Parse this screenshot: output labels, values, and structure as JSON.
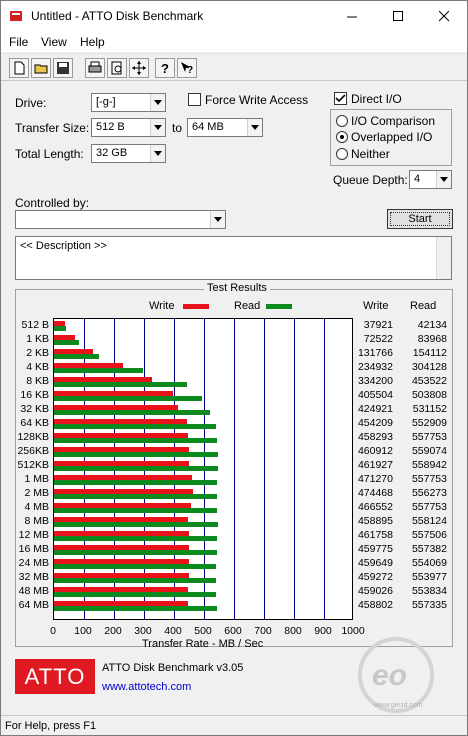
{
  "window": {
    "title": "Untitled - ATTO Disk Benchmark"
  },
  "menu": {
    "items": [
      "File",
      "View",
      "Help"
    ]
  },
  "controls": {
    "drive_label": "Drive:",
    "drive_value": "[-g-]",
    "force_write_label": "Force Write Access",
    "force_write_checked": false,
    "transfer_size_label": "Transfer Size:",
    "transfer_from": "512 B",
    "to_label": "to",
    "transfer_to": "64 MB",
    "total_length_label": "Total Length:",
    "total_length_value": "32 GB",
    "direct_io_label": "Direct I/O",
    "direct_io_checked": true,
    "io_comparison_label": "I/O Comparison",
    "overlapped_io_label": "Overlapped I/O",
    "neither_label": "Neither",
    "selected_io": "Overlapped I/O",
    "queue_depth_label": "Queue Depth:",
    "queue_depth_value": "4",
    "controlled_by_label": "Controlled by:",
    "controlled_by_value": "",
    "start_label": "Start",
    "description_text": "<< Description >>"
  },
  "results": {
    "title": "Test Results",
    "legend_write": "Write",
    "legend_read": "Read",
    "col_write": "Write",
    "col_read": "Read",
    "x_axis_label": "Transfer Rate - MB / Sec",
    "x_ticks": [
      "0",
      "100",
      "200",
      "300",
      "400",
      "500",
      "600",
      "700",
      "800",
      "900",
      "1000"
    ],
    "write_color": "#e8131a",
    "read_color": "#0d8a1d"
  },
  "chart_data": {
    "type": "bar",
    "orientation": "horizontal",
    "xlabel": "Transfer Rate - MB / Sec",
    "xlim": [
      0,
      1000
    ],
    "categories": [
      "512 B",
      "1 KB",
      "2 KB",
      "4 KB",
      "8 KB",
      "16 KB",
      "32 KB",
      "64 KB",
      "128KB",
      "256KB",
      "512KB",
      "1 MB",
      "2 MB",
      "4 MB",
      "8 MB",
      "12 MB",
      "16 MB",
      "24 MB",
      "32 MB",
      "48 MB",
      "64 MB"
    ],
    "series": [
      {
        "name": "Write",
        "values": [
          37921,
          72522,
          131766,
          234932,
          334200,
          405504,
          424921,
          454209,
          458293,
          460912,
          461927,
          471270,
          474468,
          466552,
          458895,
          461758,
          459775,
          459649,
          459272,
          459026,
          458802
        ]
      },
      {
        "name": "Read",
        "values": [
          42134,
          83968,
          154112,
          304128,
          453522,
          503808,
          531152,
          552909,
          557753,
          559074,
          558942,
          557753,
          556273,
          557753,
          558124,
          557506,
          557382,
          554069,
          553977,
          553834,
          557335
        ]
      }
    ]
  },
  "footer": {
    "logo_text": "ATTO",
    "product": "ATTO Disk Benchmark v3.05",
    "link": "www.attotech.com",
    "watermark_url": "www.gecid.com"
  },
  "status": {
    "text": "For Help, press F1"
  }
}
